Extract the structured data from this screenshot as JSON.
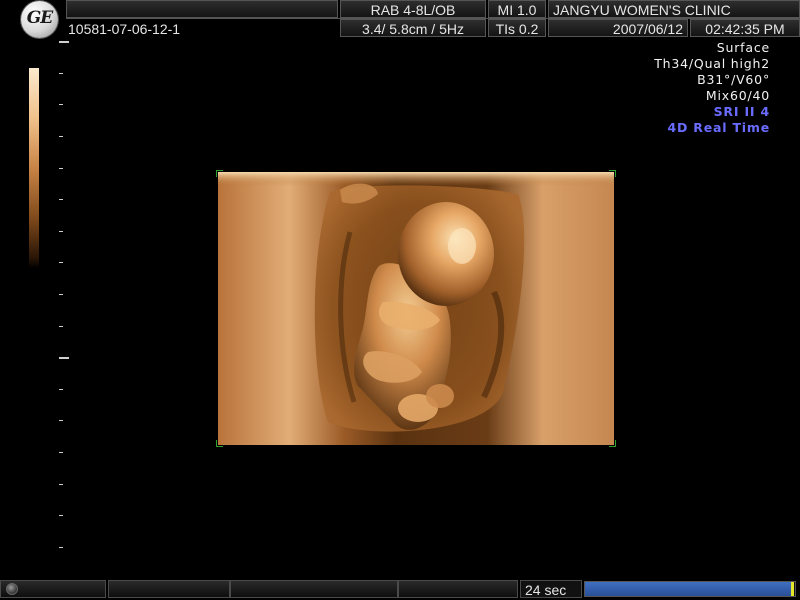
{
  "header": {
    "logo_text": "GE",
    "patient_id": "10581-07-06-12-1",
    "probe": "RAB 4-8L/OB",
    "depth_freq": "3.4/ 5.8cm /  5Hz",
    "mi": "MI  1.0",
    "tis": "TIs  0.2",
    "clinic": "JANGYU WOMEN'S CLINIC",
    "date": "2007/06/12",
    "time": "02:42:35 PM"
  },
  "params": {
    "items": [
      {
        "text": "Surface",
        "color": "#f2f2f2"
      },
      {
        "text": "Th34/Qual high2",
        "color": "#f2f2f2"
      },
      {
        "text": "B31°/V60°",
        "color": "#f2f2f2"
      },
      {
        "text": "Mix60/40",
        "color": "#f2f2f2"
      },
      {
        "text": "SRI II 4",
        "color": "#6a6cff"
      },
      {
        "text": "4D Real Time",
        "color": "#6a6cff"
      }
    ]
  },
  "footer": {
    "cine_time": "24 sec",
    "cine_progress": 0.98
  },
  "colors": {
    "accent_blue": "#6a6cff",
    "cine_bar": "#3f6fc0",
    "crop_corner": "#2ea02e",
    "render_tone": "#c88446"
  },
  "icons": {
    "logo": "ge-logo-icon",
    "knob": "trackball-icon"
  }
}
